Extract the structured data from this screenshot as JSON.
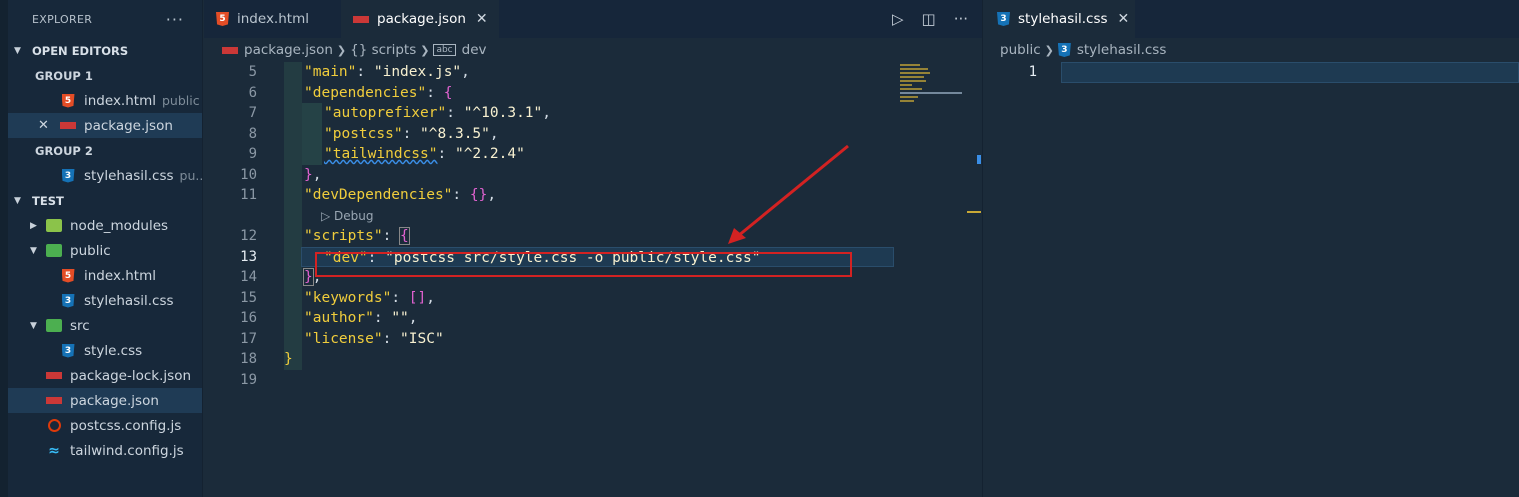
{
  "sidebar": {
    "title": "EXPLORER",
    "more": "···",
    "open_editors": {
      "label": "OPEN EDITORS",
      "group1": "GROUP 1",
      "group1_items": [
        {
          "name": "index.html",
          "desc": "public",
          "icon": "html-file-icon"
        },
        {
          "name": "package.json",
          "desc": "",
          "icon": "npm-file-icon"
        }
      ],
      "group2": "GROUP 2",
      "group2_items": [
        {
          "name": "stylehasil.css",
          "desc": "pu...",
          "icon": "css-file-icon"
        }
      ]
    },
    "project": {
      "label": "TEST",
      "items": [
        {
          "name": "node_modules",
          "icon": "node-modules-folder-icon"
        },
        {
          "name": "public",
          "icon": "public-folder-icon"
        },
        {
          "name": "index.html",
          "icon": "html-file-icon"
        },
        {
          "name": "stylehasil.css",
          "icon": "css-file-icon"
        },
        {
          "name": "src",
          "icon": "src-folder-icon"
        },
        {
          "name": "style.css",
          "icon": "css-file-icon"
        },
        {
          "name": "package-lock.json",
          "icon": "npm-file-icon"
        },
        {
          "name": "package.json",
          "icon": "npm-file-icon"
        },
        {
          "name": "postcss.config.js",
          "icon": "postcss-icon"
        },
        {
          "name": "tailwind.config.js",
          "icon": "tailwind-icon"
        }
      ]
    }
  },
  "editor_left": {
    "tabs": [
      {
        "label": "index.html",
        "icon": "html-file-icon"
      },
      {
        "label": "package.json",
        "icon": "npm-file-icon",
        "active": true
      }
    ],
    "breadcrumb": [
      "package.json",
      "{} scripts",
      "dev"
    ],
    "line_numbers": [
      "5",
      "6",
      "7",
      "8",
      "9",
      "10",
      "11",
      "12",
      "13",
      "14",
      "15",
      "16",
      "17",
      "18",
      "19"
    ],
    "codelens": "Debug",
    "code": {
      "l5": [
        "\"main\"",
        ": ",
        "\"index.js\"",
        ","
      ],
      "l6": [
        "\"dependencies\"",
        ": ",
        "{"
      ],
      "l7": [
        "\"autoprefixer\"",
        ": ",
        "\"^10.3.1\"",
        ","
      ],
      "l8": [
        "\"postcss\"",
        ": ",
        "\"^8.3.5\"",
        ","
      ],
      "l9": [
        "\"tailwindcss\"",
        ": ",
        "\"^2.2.4\""
      ],
      "l10": [
        "}",
        ","
      ],
      "l11": [
        "\"devDependencies\"",
        ": ",
        "{}",
        ","
      ],
      "l12": [
        "\"scripts\"",
        ": ",
        "{"
      ],
      "l13": [
        "\"dev\"",
        ": ",
        "\"postcss src/style.css -o public/style.css\""
      ],
      "l14": [
        "}",
        ","
      ],
      "l15": [
        "\"keywords\"",
        ": ",
        "[]",
        ","
      ],
      "l16": [
        "\"author\"",
        ": ",
        "\"\"",
        ","
      ],
      "l17": [
        "\"license\"",
        ": ",
        "\"ISC\""
      ],
      "l18": [
        "}"
      ]
    }
  },
  "editor_right": {
    "tab": {
      "label": "stylehasil.css",
      "icon": "css-file-icon"
    },
    "breadcrumb": [
      "public",
      "stylehasil.css"
    ],
    "line_numbers": [
      "1"
    ]
  },
  "colors": {
    "annotation": "#d32222",
    "accent": "#1f3b55"
  }
}
